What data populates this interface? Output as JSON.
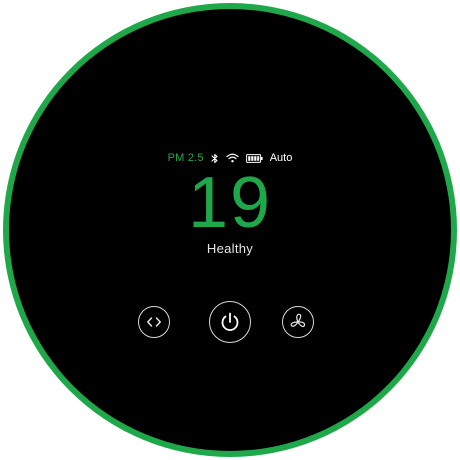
{
  "status": {
    "pm_label": "PM 2.5",
    "icons": [
      "bluetooth-icon",
      "wifi-icon",
      "battery-icon"
    ],
    "mode": "Auto"
  },
  "reading": {
    "value": "19",
    "quality": "Healthy"
  },
  "controls": {
    "buttons": [
      "mode-button",
      "power-button",
      "fan-button"
    ]
  },
  "colors": {
    "accent": "#1fa84a",
    "display_bg": "#000000",
    "ring": "#1fa84a",
    "icon": "#d8d8d8"
  }
}
